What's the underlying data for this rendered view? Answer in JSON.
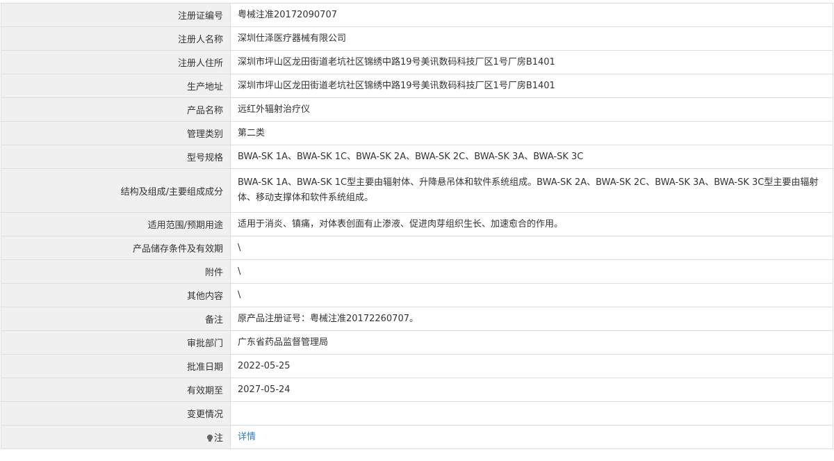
{
  "rows": [
    {
      "label": "注册证编号",
      "value": "粤械注准20172090707"
    },
    {
      "label": "注册人名称",
      "value": "深圳仕泽医疗器械有限公司"
    },
    {
      "label": "注册人住所",
      "value": "深圳市坪山区龙田街道老坑社区锦绣中路19号美讯数码科技厂区1号厂房B1401"
    },
    {
      "label": "生产地址",
      "value": "深圳市坪山区龙田街道老坑社区锦绣中路19号美讯数码科技厂区1号厂房B1401"
    },
    {
      "label": "产品名称",
      "value": "远红外辐射治疗仪"
    },
    {
      "label": "管理类别",
      "value": "第二类"
    },
    {
      "label": "型号规格",
      "value": "BWA-SK 1A、BWA-SK 1C、BWA-SK 2A、BWA-SK 2C、BWA-SK 3A、BWA-SK 3C"
    },
    {
      "label": "结构及组成/主要组成成分",
      "value": "BWA-SK 1A、BWA-SK 1C型主要由辐射体、升降悬吊体和软件系统组成。BWA-SK 2A、BWA-SK 2C、BWA-SK 3A、BWA-SK 3C型主要由辐射体、移动支撑体和软件系统组成。"
    },
    {
      "label": "适用范围/预期用途",
      "value": "适用于消炎、镇痛，对体表创面有止渗液、促进肉芽组织生长、加速愈合的作用。"
    },
    {
      "label": "产品储存条件及有效期",
      "value": "\\"
    },
    {
      "label": "附件",
      "value": "\\"
    },
    {
      "label": "其他内容",
      "value": "\\"
    },
    {
      "label": "备注",
      "value": "原产品注册证号：粤械注准20172260707。"
    },
    {
      "label": "审批部门",
      "value": "广东省药品监督管理局"
    },
    {
      "label": "批准日期",
      "value": "2022-05-25"
    },
    {
      "label": "有效期至",
      "value": "2027-05-24"
    },
    {
      "label": "变更情况",
      "value": ""
    }
  ],
  "note": {
    "label": "注",
    "link_label": "详情",
    "icon": "lightbulb-icon"
  },
  "colors": {
    "label_bg": "#f0f0f0",
    "border": "#dddddd",
    "text": "#333333",
    "link": "#2a7bc1"
  }
}
